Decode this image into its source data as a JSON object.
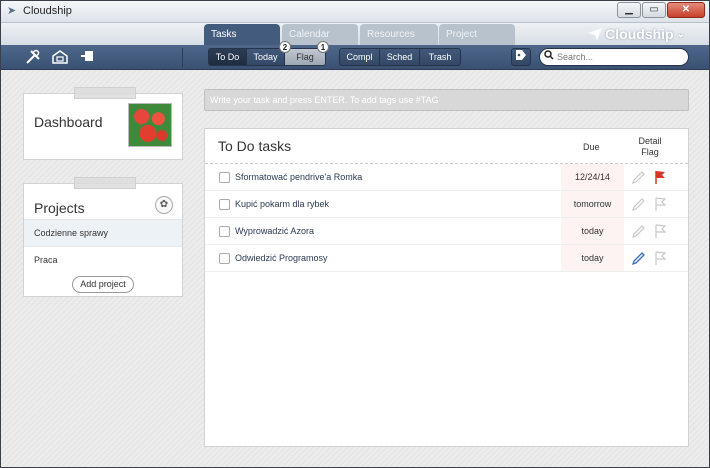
{
  "window": {
    "title": "Cloudship",
    "minimize": "▁",
    "maximize": "▭",
    "close": "✕"
  },
  "tabs": [
    {
      "label": "Tasks",
      "state": "active"
    },
    {
      "label": "Calendar",
      "state": "inactive"
    },
    {
      "label": "Resources",
      "state": "inactive"
    },
    {
      "label": "Project",
      "state": "inactive"
    }
  ],
  "brand": {
    "name": "Cloudship",
    "icon": "paper-plane-icon",
    "dropdown": "⌄"
  },
  "toolbar": {
    "icons": [
      "tools-icon",
      "inbox-icon",
      "pin-icon"
    ],
    "views": [
      {
        "label": "To Do",
        "selected": true
      },
      {
        "label": "Today",
        "badge": "2"
      },
      {
        "label": "Flag",
        "badge": "1"
      }
    ],
    "filters": [
      "Compl",
      "Sched",
      "Trash"
    ],
    "tag_icon": "tag-icon",
    "search_placeholder": "Search..."
  },
  "dashboard": {
    "title": "Dashboard"
  },
  "projects": {
    "title": "Projects",
    "items": [
      {
        "label": "Codzienne sprawy",
        "selected": true
      },
      {
        "label": "Praca",
        "selected": false
      }
    ],
    "add_label": "Add project"
  },
  "task_input": {
    "placeholder": "Write your task and press ENTER. To add tags use #TAG"
  },
  "task_list": {
    "title": "To Do tasks",
    "col_due": "Due",
    "col_detail": "Detail",
    "col_flag": "Flag",
    "tasks": [
      {
        "name": "Sformatować pendrive'a Romka",
        "due": "12/24/14",
        "flagged": true,
        "has_detail": false
      },
      {
        "name": "Kupić pokarm dla rybek",
        "due": "tomorrow",
        "flagged": false,
        "has_detail": false
      },
      {
        "name": "Wyprowadzić Azora",
        "due": "today",
        "flagged": false,
        "has_detail": false
      },
      {
        "name": "Odwiedzić Programosy",
        "due": "today",
        "flagged": false,
        "has_detail": true
      }
    ]
  },
  "colors": {
    "accent": "#435c7d",
    "flag_red": "#d9352a",
    "detail_blue": "#3b6fb6"
  }
}
